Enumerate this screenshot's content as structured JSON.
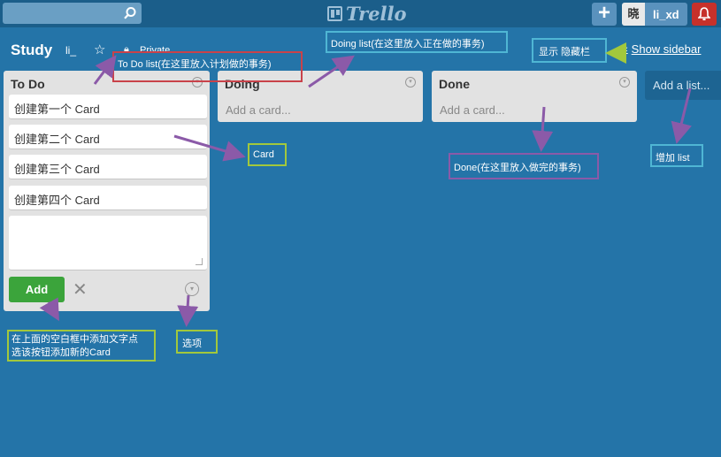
{
  "topbar": {
    "search_placeholder": "",
    "logo_text": "Trello",
    "add_label": "+",
    "user_avatar": "晓",
    "user_name": "li_xd"
  },
  "board": {
    "title": "Study",
    "org": "li_",
    "privacy": "Private",
    "show_sidebar": "Show sidebar"
  },
  "lists": [
    {
      "name": "To Do",
      "cards": [
        "创建第一个 Card",
        "创建第二个 Card",
        "创建第三个 Card",
        "创建第四个 Card"
      ],
      "add_button": "Add"
    },
    {
      "name": "Doing",
      "add_card": "Add a card..."
    },
    {
      "name": "Done",
      "add_card": "Add a card..."
    }
  ],
  "add_list": "Add a list...",
  "annotations": {
    "todo": "To Do list(在这里放入计划做的事务)",
    "doing": "Doing list(在这里放入正在做的事务)",
    "sidebar": "显示 隐藏栏",
    "card": "Card",
    "done": "Done(在这里放入做完的事务)",
    "add_list": "增加 list",
    "add_hint_1": "在上面的空白框中添加文字点",
    "add_hint_2": "选该按钮添加新的Card",
    "options": "选项"
  },
  "colors": {
    "background": "#2474a8",
    "topbar": "#1b5e8a",
    "add_button": "#3ba43b",
    "bell": "#c6312b"
  }
}
